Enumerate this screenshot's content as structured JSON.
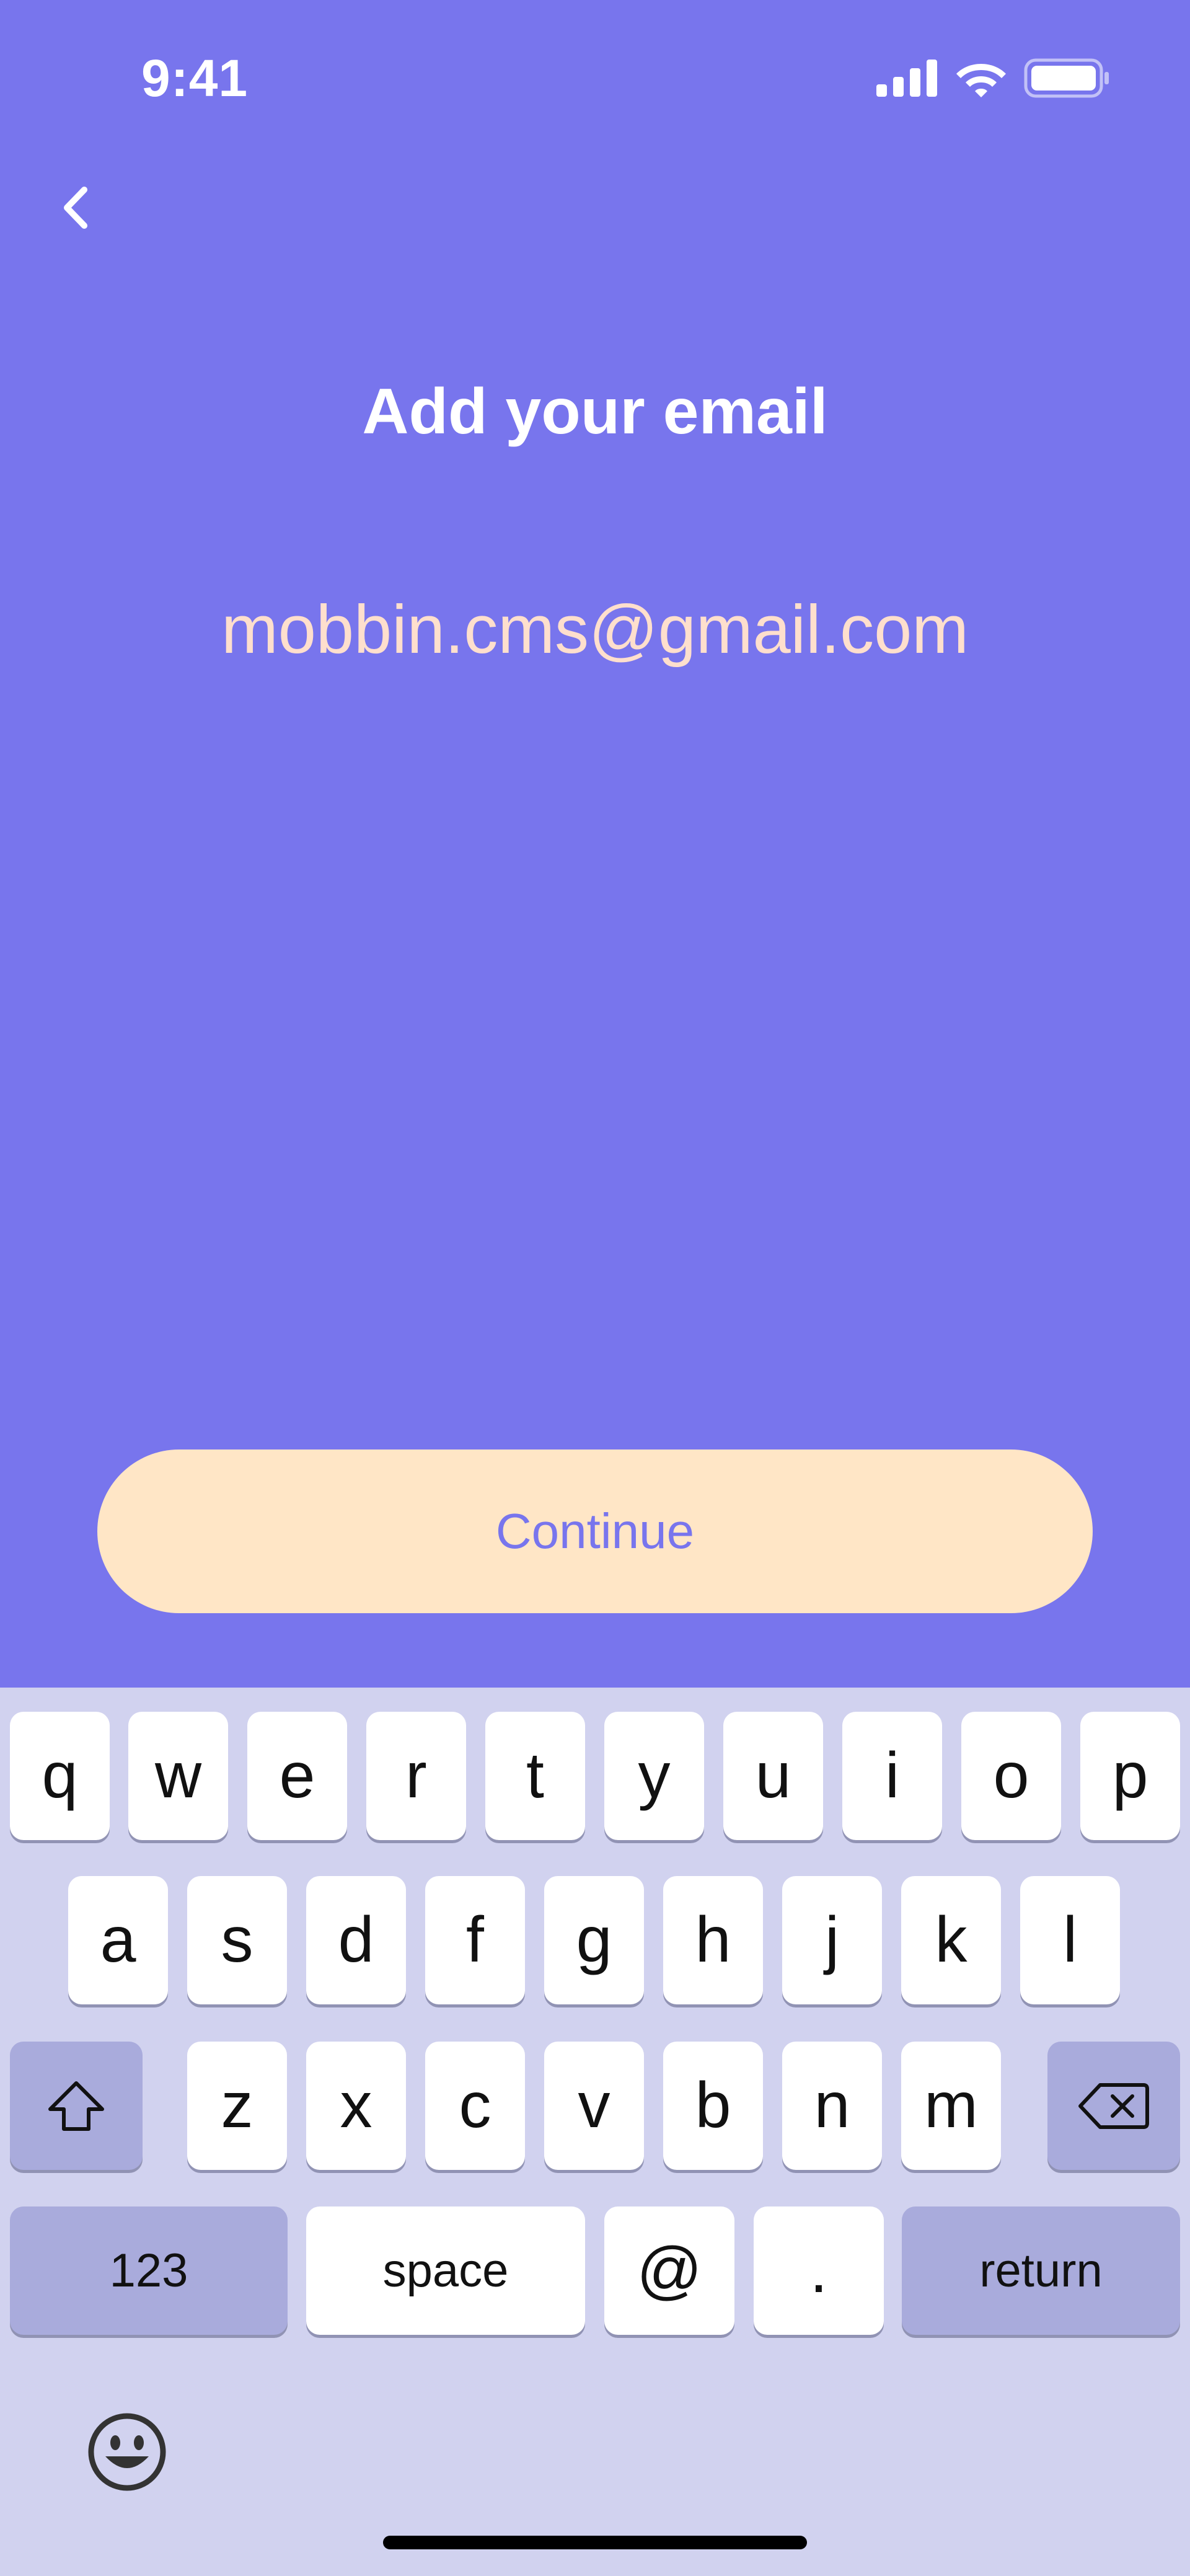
{
  "status_bar": {
    "time": "9:41",
    "icons": [
      "signal-icon",
      "wifi-icon",
      "battery-icon"
    ]
  },
  "nav": {
    "back_icon": "chevron-left-icon"
  },
  "title": "Add your email",
  "email_field": {
    "value": "mobbin.cms@gmail.com",
    "placeholder": ""
  },
  "continue_label": "Continue",
  "keyboard": {
    "row1": [
      "q",
      "w",
      "e",
      "r",
      "t",
      "y",
      "u",
      "i",
      "o",
      "p"
    ],
    "row2": [
      "a",
      "s",
      "d",
      "f",
      "g",
      "h",
      "j",
      "k",
      "l"
    ],
    "row3": [
      "z",
      "x",
      "c",
      "v",
      "b",
      "n",
      "m"
    ],
    "numbers_label": "123",
    "space_label": "space",
    "at_label": "@",
    "dot_label": ".",
    "return_label": "return",
    "shift_icon": "shift-icon",
    "delete_icon": "delete-icon",
    "emoji_icon": "emoji-icon"
  },
  "colors": {
    "background": "#7875ED",
    "email_text": "#FEDFCD",
    "button_bg": "#FFE6C6",
    "button_text": "#7875ED",
    "keyboard_bg": "#D1D2EF"
  }
}
